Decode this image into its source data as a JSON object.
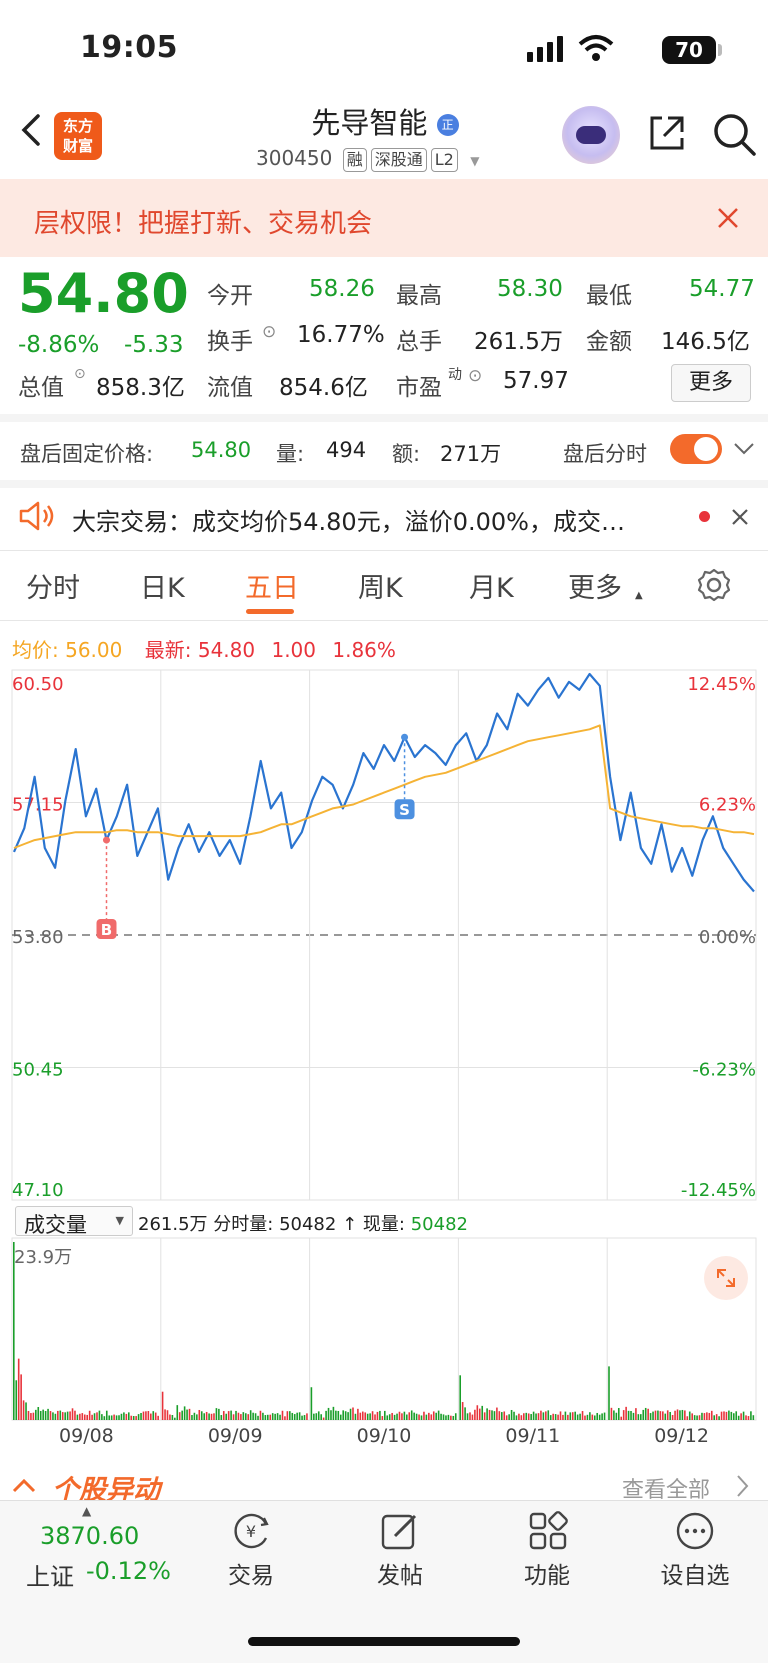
{
  "status": {
    "time": "19:05",
    "battery": "70"
  },
  "header": {
    "logo_top": "东方",
    "logo_bottom": "财富",
    "title": "先导智能",
    "verified_badge": "正",
    "code": "300450",
    "tags": [
      "融",
      "深股通",
      "L2"
    ]
  },
  "banner": {
    "text": "层权限！把握打新、交易机会"
  },
  "quote": {
    "price": "54.80",
    "change_pct": "-8.86%",
    "change_amt": "-5.33",
    "stats": [
      {
        "label": "今开",
        "value": "58.26",
        "color": "#1a9e2a"
      },
      {
        "label": "最高",
        "value": "58.30",
        "color": "#1a9e2a"
      },
      {
        "label": "最低",
        "value": "54.77",
        "color": "#1a9e2a"
      },
      {
        "label": "换手",
        "value": "16.77%",
        "color": "#222222"
      },
      {
        "label": "总手",
        "value": "261.5万",
        "color": "#222222"
      },
      {
        "label": "金额",
        "value": "146.5亿",
        "color": "#222222"
      },
      {
        "label": "总值",
        "value": "858.3亿",
        "color": "#222222"
      },
      {
        "label": "流值",
        "value": "854.6亿",
        "color": "#222222"
      },
      {
        "label": "市盈",
        "value": "57.97",
        "color": "#222222",
        "sup": "动"
      }
    ],
    "more_button": "更多"
  },
  "after_hours": {
    "label": "盘后固定价格:",
    "price": "54.80",
    "vol_label": "量:",
    "vol": "494",
    "amt_label": "额:",
    "amt": "271万",
    "toggle_label": "盘后分时",
    "toggle_on": true
  },
  "block_trade": {
    "text": "大宗交易：成交均价54.80元，溢价0.00%，成交…"
  },
  "tabs": [
    {
      "label": "分时"
    },
    {
      "label": "日K"
    },
    {
      "label": "五日",
      "active": true
    },
    {
      "label": "周K"
    },
    {
      "label": "月K"
    },
    {
      "label": "更多"
    }
  ],
  "legend": {
    "avg_label": "均价:",
    "avg": "56.00",
    "last_label": "最新:",
    "last": "54.80",
    "chg": "1.00",
    "chg_pct": "1.86%"
  },
  "chart_data": {
    "type": "line",
    "x_labels": [
      "09/08",
      "09/09",
      "09/10",
      "09/11",
      "09/12"
    ],
    "y_ticks_left": [
      "60.50",
      "57.15",
      "53.80",
      "50.45",
      "47.10"
    ],
    "y_ticks_right": [
      "12.45%",
      "6.23%",
      "0.00%",
      "-6.23%",
      "-12.45%"
    ],
    "ylim": [
      47.1,
      60.5
    ],
    "baseline": 53.8,
    "markers": [
      {
        "label": "B",
        "day": "09/08"
      },
      {
        "label": "S",
        "day": "09/10"
      }
    ],
    "series": [
      {
        "name": "最新",
        "color": "#2a74d0",
        "values": [
          55.9,
          56.5,
          57.8,
          56.0,
          55.5,
          57.2,
          58.5,
          56.8,
          57.5,
          56.2,
          56.8,
          57.6,
          55.8,
          56.4,
          57.0,
          55.2,
          56.0,
          56.6,
          55.9,
          56.4,
          55.8,
          56.2,
          55.6,
          56.8,
          58.2,
          57.0,
          57.4,
          56.0,
          56.4,
          57.2,
          57.8,
          57.6,
          57.0,
          57.6,
          58.4,
          58.0,
          58.6,
          58.2,
          58.8,
          58.3,
          58.6,
          58.4,
          58.1,
          58.6,
          58.9,
          58.2,
          58.6,
          59.4,
          59.0,
          59.9,
          59.6,
          60.0,
          60.3,
          59.8,
          60.2,
          60.0,
          60.4,
          60.1,
          57.8,
          56.2,
          57.4,
          56.0,
          55.6,
          56.6,
          55.4,
          56.0,
          55.3,
          56.2,
          56.8,
          56.0,
          55.6,
          55.2,
          54.9
        ]
      },
      {
        "name": "均价",
        "color": "#f5b335",
        "values": [
          56.0,
          56.1,
          56.2,
          56.25,
          56.3,
          56.35,
          56.4,
          56.4,
          56.4,
          56.4,
          56.45,
          56.45,
          56.4,
          56.4,
          56.4,
          56.35,
          56.3,
          56.3,
          56.3,
          56.3,
          56.3,
          56.3,
          56.3,
          56.35,
          56.4,
          56.5,
          56.6,
          56.6,
          56.7,
          56.8,
          56.9,
          57.0,
          57.05,
          57.1,
          57.2,
          57.3,
          57.4,
          57.5,
          57.6,
          57.7,
          57.8,
          57.85,
          57.9,
          58.0,
          58.1,
          58.2,
          58.3,
          58.4,
          58.5,
          58.6,
          58.7,
          58.75,
          58.8,
          58.85,
          58.9,
          58.95,
          59.0,
          59.1,
          57.0,
          56.9,
          56.8,
          56.75,
          56.7,
          56.65,
          56.6,
          56.55,
          56.55,
          56.5,
          56.5,
          56.45,
          56.4,
          56.4,
          56.35
        ]
      }
    ],
    "volume": {
      "label": "成交量",
      "total": "261.5万",
      "period_label": "分时量:",
      "period": "50482",
      "current_label": "现量:",
      "current": "50482",
      "ymax_label": "23.9万",
      "spikes": [
        23.9,
        3.8,
        4.4,
        6.0,
        7.2
      ]
    }
  },
  "movers": {
    "title": "个股异动",
    "link": "查看全部"
  },
  "index": {
    "value": "3870.60",
    "name": "上证",
    "chg": "-0.12%"
  },
  "nav": [
    {
      "label": "交易"
    },
    {
      "label": "发帖"
    },
    {
      "label": "功能"
    },
    {
      "label": "设自选"
    }
  ]
}
